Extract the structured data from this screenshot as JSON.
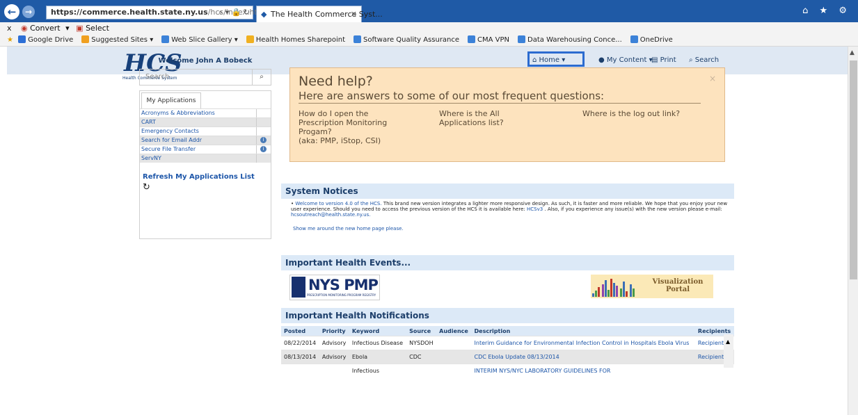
{
  "browser": {
    "url_site": "https://commerce.health.state.ny.us",
    "url_path": "/hcs/index.html",
    "url_tools": "⌕ ▾ 🔒 ↻",
    "tab_title": "The Health Commerce Syst...",
    "tab_close": "✕",
    "back_glyph": "←",
    "forward_glyph": "→",
    "window_icons": "⌂ ★ ⚙"
  },
  "command_bar": {
    "close": "x",
    "convert": "Convert",
    "select": "Select"
  },
  "favorites": [
    {
      "label": "Google Drive",
      "color": "#2d6fd6"
    },
    {
      "label": "Suggested Sites ▾",
      "color": "#f0a020"
    },
    {
      "label": "Web Slice Gallery ▾",
      "color": "#3c82d8"
    },
    {
      "label": "Health Homes Sharepoint",
      "color": "#f0b020"
    },
    {
      "label": "Software Quality Assurance",
      "color": "#3c82d8"
    },
    {
      "label": "CMA VPN",
      "color": "#3c82d8"
    },
    {
      "label": "Data Warehousing Conce...",
      "color": "#3c82d8"
    },
    {
      "label": "OneDrive",
      "color": "#3c82d8"
    }
  ],
  "logo": {
    "text": "HCS",
    "subtitle": "Health Commerce System"
  },
  "top_nav": {
    "home": "Home",
    "my_content": "My Content",
    "print": "Print",
    "search": "Search"
  },
  "sidebar": {
    "welcome": "Welcome John A Bobeck",
    "search_placeholder": "Search",
    "apps_tab": "My Applications",
    "apps": [
      {
        "label": "Acronyms & Abbreviations",
        "info": false
      },
      {
        "label": "CART",
        "info": false
      },
      {
        "label": "Emergency Contacts",
        "info": false
      },
      {
        "label": "Search for Email Addr",
        "info": true
      },
      {
        "label": "Secure File Transfer",
        "info": true
      },
      {
        "label": "ServNY",
        "info": false
      }
    ],
    "refresh": "Refresh My Applications List"
  },
  "help": {
    "title": "Need help?",
    "subtitle": "Here are answers to some of our most frequent questions:",
    "close": "×",
    "q1": [
      "How do I open the",
      "Prescription Monitoring",
      "Progam?",
      "(aka: PMP, iStop, CSI)"
    ],
    "q2": [
      "Where is the All",
      "Applications list?"
    ],
    "q3": [
      "Where is the log out link?"
    ]
  },
  "system_notices": {
    "heading": "System Notices",
    "text_a": "Welcome to version 4.0 of the HCS.",
    "text_b": " This brand new version integrates a lighter more responsive design. As such, it is faster and more reliable. We hope that you enjoy your new user experience. Should you need to access the previous version of the HCS it is available here: ",
    "link_v3": "HCSv3",
    "text_c": " . Also, if you experience any issue(s) with the new version please e-mail: ",
    "email": "hcsoutreach@health.state.ny.us.",
    "tour": "Show me around the new home page please."
  },
  "events": {
    "heading": "Important Health Events...",
    "pmp_text": "NYS PMP",
    "pmp_small": "PRESCRIPTION MONITORING PROGRAM REGISTRY",
    "viz_label_1": "Visualization",
    "viz_label_2": "Portal"
  },
  "notifications": {
    "heading": "Important Health Notifications",
    "columns": [
      "Posted",
      "Priority",
      "Keyword",
      "Source",
      "Audience",
      "Description",
      "Recipients"
    ],
    "rows": [
      {
        "posted": "08/22/2014",
        "priority": "Advisory",
        "keyword": "Infectious Disease",
        "source": "NYSDOH",
        "audience": "",
        "description": "Interim Guidance for Environmental Infection Control in Hospitals Ebola Virus",
        "recipients": "Recipients"
      },
      {
        "posted": "08/13/2014",
        "priority": "Advisory",
        "keyword": "Ebola",
        "source": "CDC",
        "audience": "",
        "description": "CDC Ebola Update 08/13/2014",
        "recipients": "Recipients"
      },
      {
        "posted": "",
        "priority": "",
        "keyword": "Infectious",
        "source": "",
        "audience": "",
        "description": "INTERIM NYS/NYC LABORATORY GUIDELINES FOR",
        "recipients": ""
      }
    ]
  }
}
